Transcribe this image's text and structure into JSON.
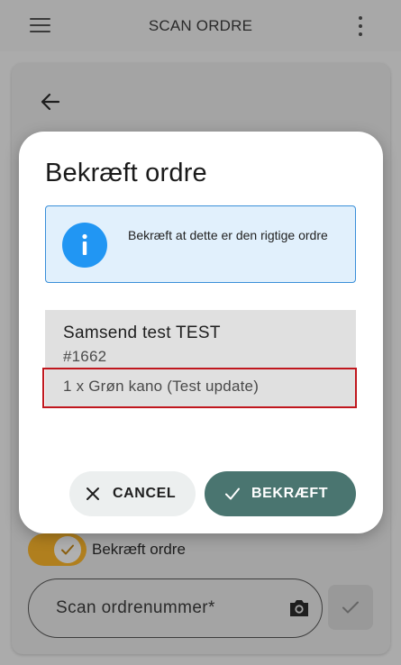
{
  "app_bar": {
    "title": "SCAN ORDRE",
    "menu_icon": "hamburger-menu-icon",
    "more_icon": "more-vertical-icon"
  },
  "background": {
    "back_icon": "arrow-left-icon",
    "confirm_toggle": {
      "label": "Bekræft ordre",
      "checked": true,
      "accent_color": "#b07f1e"
    },
    "scan_field": {
      "label": "Scan ordrenummer*",
      "value": "",
      "icon": "camera-icon"
    },
    "submit_icon": "checkmark-icon"
  },
  "dialog": {
    "title": "Bekræft ordre",
    "info": {
      "icon": "info-icon",
      "text": "Bekræft at dette er den rigtige ordre",
      "color": "#2196f3"
    },
    "order": {
      "name": "Samsend test TEST",
      "number": "#1662",
      "lines": [
        "1 x Grøn kano (Test update)"
      ]
    },
    "buttons": {
      "cancel": {
        "label": "CANCEL",
        "icon": "close-icon"
      },
      "confirm": {
        "label": "BEKRÆFT",
        "icon": "checkmark-icon",
        "color": "#4a7570"
      }
    }
  }
}
